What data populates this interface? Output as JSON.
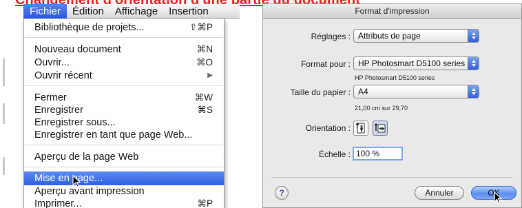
{
  "headline": "Changement d'orientation d'une partie du document",
  "menubar": {
    "items": [
      "Fichier",
      "Édition",
      "Affichage",
      "Insertion"
    ],
    "active_index": 0
  },
  "file_menu": {
    "items": [
      {
        "label": "Bibliothèque de projets...",
        "shortcut": "⇧⌘P"
      },
      {
        "label": "Nouveau document",
        "shortcut": "⌘N"
      },
      {
        "label": "Ouvrir...",
        "shortcut": "⌘O"
      },
      {
        "label": "Ouvrir récent",
        "shortcut": ""
      },
      {
        "label": "Fermer",
        "shortcut": "⌘W"
      },
      {
        "label": "Enregistrer",
        "shortcut": "⌘S"
      },
      {
        "label": "Enregistrer sous...",
        "shortcut": ""
      },
      {
        "label": "Enregistrer en tant que page Web...",
        "shortcut": ""
      },
      {
        "label": "Aperçu de la page Web",
        "shortcut": ""
      },
      {
        "label": "Mise en page...",
        "shortcut": ""
      },
      {
        "label": "Aperçu avant impression",
        "shortcut": ""
      },
      {
        "label": "Imprimer...",
        "shortcut": "⌘P"
      }
    ],
    "selected_index": 9,
    "submenu_arrow_icon": "triangle-right-icon"
  },
  "dialog": {
    "title": "Format d'impression",
    "settings_label": "Réglages :",
    "settings_value": "Attributs de page",
    "format_for_label": "Format pour :",
    "format_for_value": "HP Photosmart D5100 series",
    "format_for_sub": "HP Photosmart D5100 series",
    "paper_size_label": "Taille du papier :",
    "paper_size_value": "A4",
    "paper_size_sub": "21,00 cm sur 29,70",
    "orientation_label": "Orientation :",
    "orientation_options": [
      "portrait",
      "landscape"
    ],
    "orientation_selected": "landscape",
    "scale_label": "Échelle :",
    "scale_value": "100 %",
    "help_label": "?",
    "cancel_label": "Annuler",
    "ok_label": "OK",
    "accent_color": "#2e5ed8"
  }
}
